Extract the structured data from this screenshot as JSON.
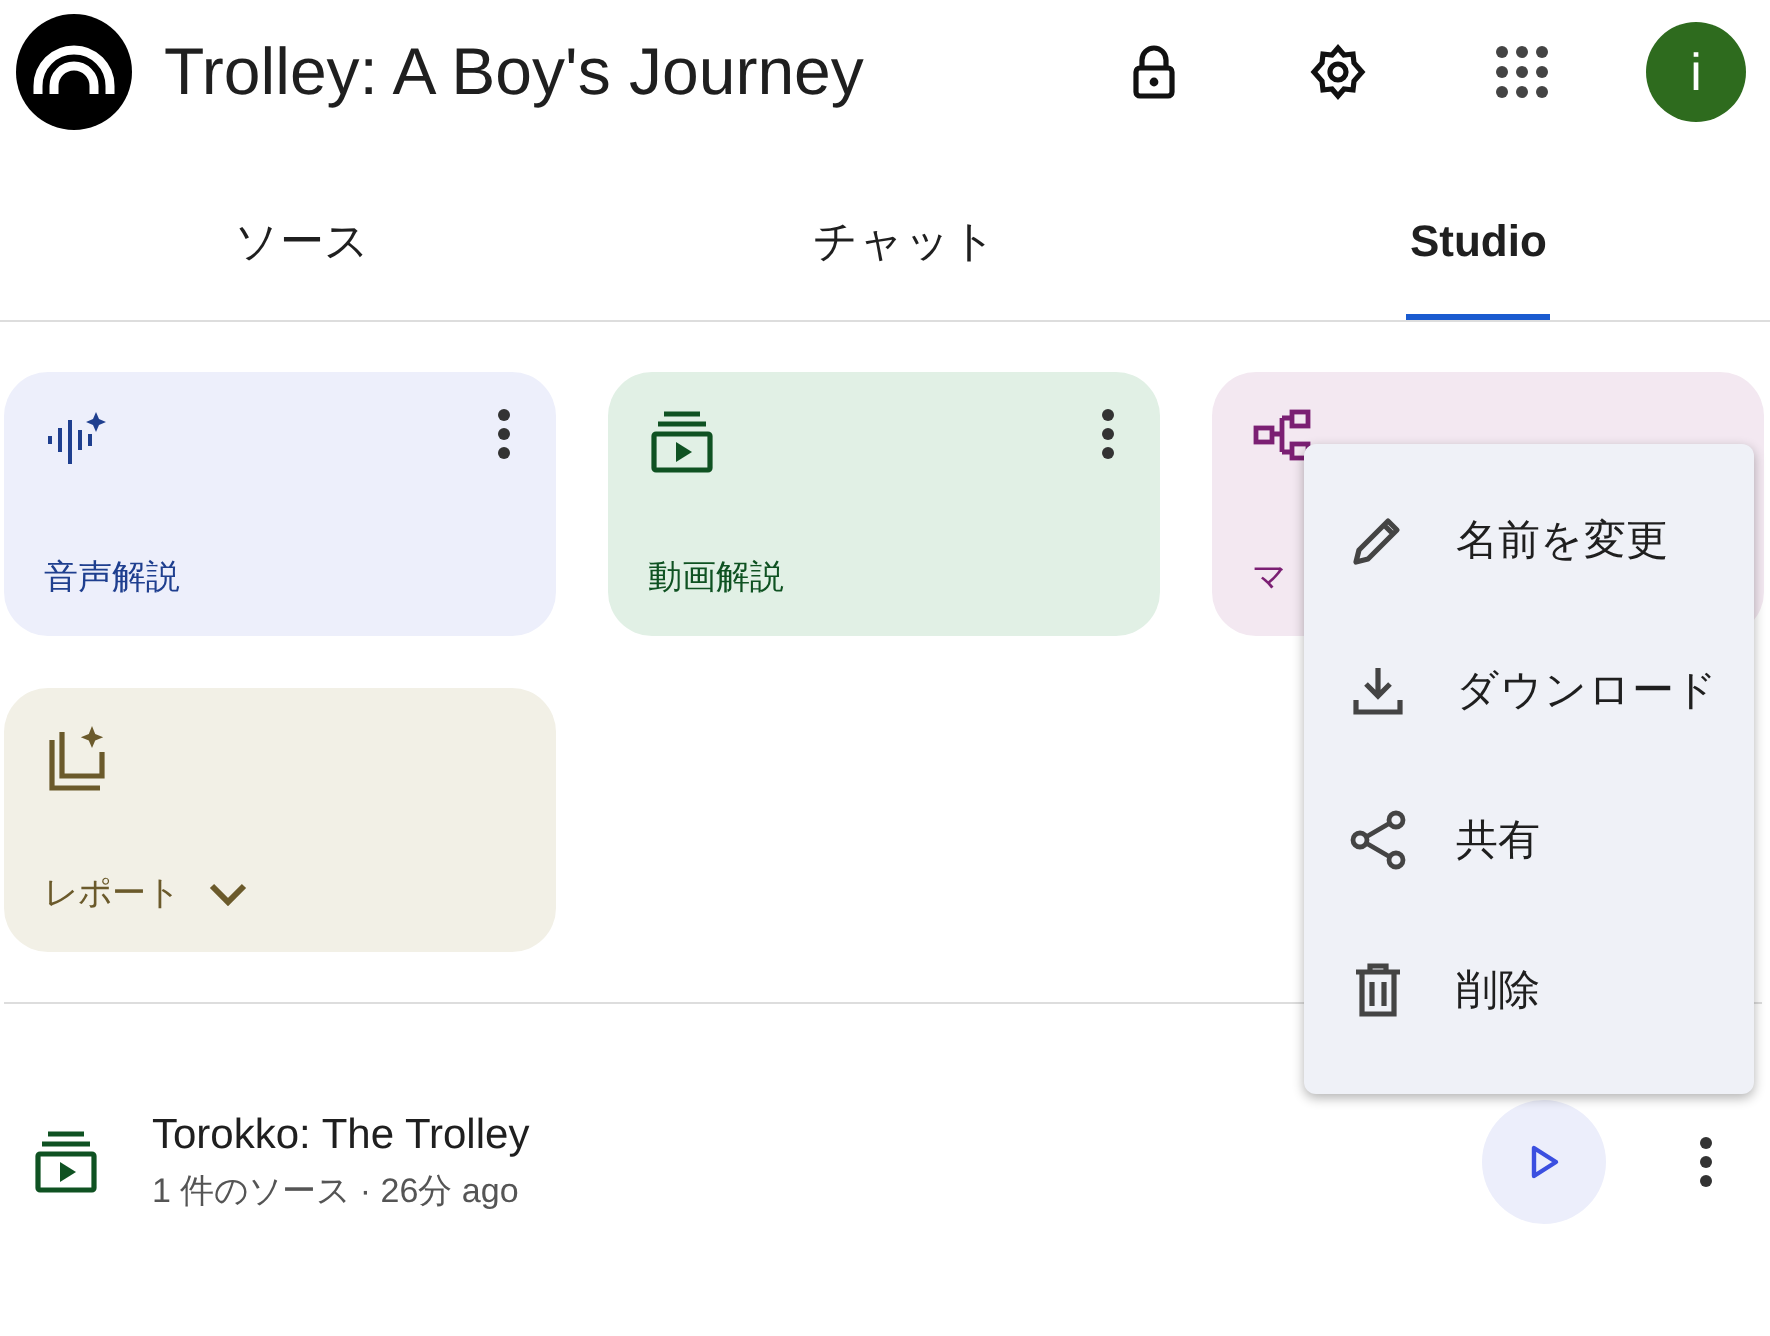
{
  "header": {
    "title": "Trolley: A Boy's Journey",
    "avatar": "i"
  },
  "tabs": [
    {
      "label": "ソース",
      "selected": false
    },
    {
      "label": "チャット",
      "selected": false
    },
    {
      "label": "Studio",
      "selected": true
    }
  ],
  "cards": [
    {
      "kind": "audio",
      "label": "音声解説",
      "color": "#1f3f8f",
      "menu": true,
      "dropdown": false
    },
    {
      "kind": "video",
      "label": "動画解説",
      "color": "#0f5222",
      "menu": true,
      "dropdown": false
    },
    {
      "kind": "mindmap",
      "label": "マ",
      "color": "#7b1f73",
      "menu": false,
      "dropdown": false
    },
    {
      "kind": "report",
      "label": "レポート",
      "color": "#6b5a2b",
      "menu": false,
      "dropdown": true
    }
  ],
  "artifacts": [
    {
      "kind": "video",
      "title": "Torokko: The Trolley",
      "meta": "1 件のソース · 26分 ago"
    }
  ],
  "context_menu": [
    {
      "kind": "rename",
      "label": "名前を変更"
    },
    {
      "kind": "download",
      "label": "ダウンロード"
    },
    {
      "kind": "share",
      "label": "共有"
    },
    {
      "kind": "delete",
      "label": "削除"
    }
  ]
}
